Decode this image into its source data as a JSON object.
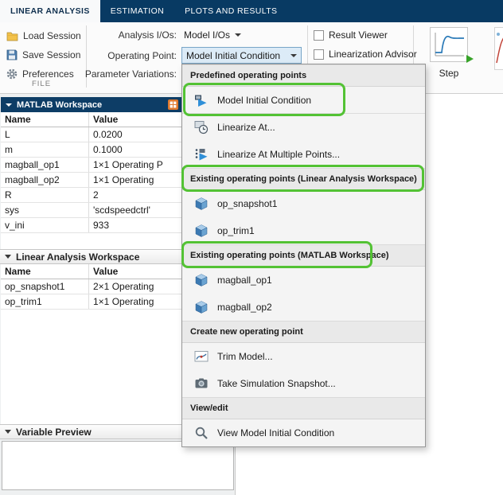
{
  "colors": {
    "tab_bar_navy": "#083a63",
    "panel_header_navy": "#0d3d66",
    "highlight_green": "#53c234",
    "open_dropdown_border": "#78a5c8"
  },
  "tab_bar": {
    "active_tab": "LINEAR ANALYSIS",
    "tabs": [
      {
        "label": "LINEAR ANALYSIS"
      },
      {
        "label": "ESTIMATION"
      },
      {
        "label": "PLOTS AND RESULTS"
      }
    ]
  },
  "ribbon": {
    "file": {
      "section_label": "FILE",
      "buttons": [
        {
          "label": "Load Session",
          "icon": "folder-open-icon"
        },
        {
          "label": "Save Session",
          "icon": "save-icon"
        },
        {
          "label": "Preferences",
          "icon": "gear-icon"
        }
      ]
    },
    "setup": {
      "analysis_ios_label": "Analysis I/Os:",
      "analysis_ios_value": "Model I/Os",
      "operating_point_label": "Operating Point:",
      "operating_point_value": "Model Initial Condition",
      "parameter_variations_label": "Parameter Variations:"
    },
    "options": {
      "checkboxes": [
        {
          "label": "Result Viewer",
          "checked": false
        },
        {
          "label": "Linearization Advisor",
          "checked": false
        }
      ]
    },
    "gallery": {
      "step_label": "Step"
    }
  },
  "menu": {
    "sections": [
      {
        "header": "Predefined operating points",
        "items": [
          {
            "label": "Model Initial Condition",
            "icon": "model-initial-condition-icon",
            "highlighted": true
          },
          {
            "label": "Linearize At...",
            "icon": "linearize-at-icon"
          },
          {
            "label": "Linearize At Multiple Points...",
            "icon": "linearize-multiple-icon"
          }
        ]
      },
      {
        "header": "Existing operating points (Linear Analysis Workspace)",
        "header_highlighted": true,
        "items": [
          {
            "label": "op_snapshot1",
            "icon": "operating-point-cube-icon"
          },
          {
            "label": "op_trim1",
            "icon": "operating-point-cube-icon"
          }
        ]
      },
      {
        "header": "Existing operating points (MATLAB Workspace)",
        "header_highlighted": true,
        "items": [
          {
            "label": "magball_op1",
            "icon": "operating-point-cube-icon"
          },
          {
            "label": "magball_op2",
            "icon": "operating-point-cube-icon"
          }
        ]
      },
      {
        "header": "Create new operating point",
        "items": [
          {
            "label": "Trim Model...",
            "icon": "trim-model-icon"
          },
          {
            "label": "Take Simulation Snapshot...",
            "icon": "snapshot-camera-icon"
          }
        ]
      },
      {
        "header": "View/edit",
        "items": [
          {
            "label": "View Model Initial Condition",
            "icon": "magnifier-icon"
          }
        ]
      }
    ]
  },
  "matlab_workspace": {
    "title": "MATLAB Workspace",
    "columns": [
      "Name",
      "Value"
    ],
    "rows": [
      {
        "name": "L",
        "value": "0.0200"
      },
      {
        "name": "m",
        "value": "0.1000"
      },
      {
        "name": "magball_op1",
        "value": "1×1 Operating P"
      },
      {
        "name": "magball_op2",
        "value": "1×1 Operating"
      },
      {
        "name": "R",
        "value": "2"
      },
      {
        "name": "sys",
        "value": "'scdspeedctrl'"
      },
      {
        "name": "v_ini",
        "value": "933"
      }
    ]
  },
  "linear_analysis_workspace": {
    "title": "Linear Analysis Workspace",
    "columns": [
      "Name",
      "Value"
    ],
    "rows": [
      {
        "name": "op_snapshot1",
        "value": "2×1 Operating"
      },
      {
        "name": "op_trim1",
        "value": "1×1 Operating"
      }
    ]
  },
  "variable_preview": {
    "title": "Variable Preview"
  }
}
